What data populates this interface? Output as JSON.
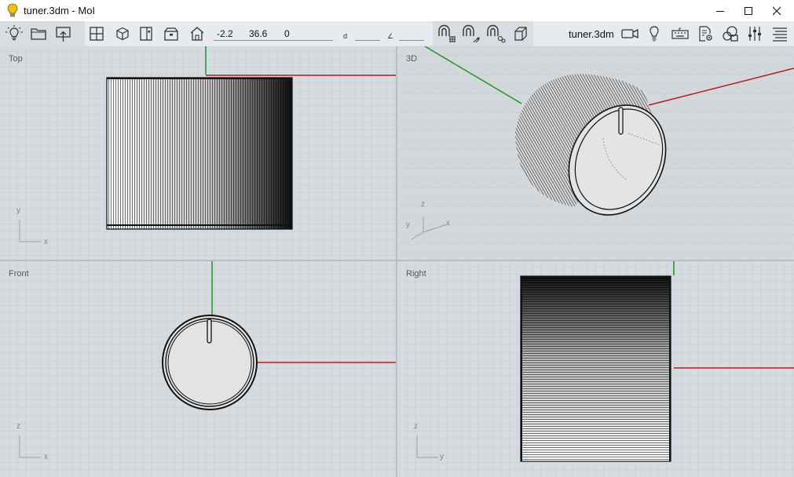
{
  "window": {
    "title": "tuner.3dm - MoI"
  },
  "toolbar": {
    "coord_x": "-2.2",
    "coord_y": "36.6",
    "coord_z": "0",
    "distance_label": "d",
    "angle_label": "∠",
    "file_name": "tuner.3dm",
    "icons": [
      "lightbulb-icon",
      "open-folder-icon",
      "import-icon",
      "four-view-icon",
      "box-3d-icon",
      "front-view-icon",
      "top-view-icon",
      "home-view-icon",
      "magnet-grid-icon",
      "magnet-point-icon",
      "magnet-object-icon",
      "cube-icon",
      "camera-icon",
      "light-icon",
      "keyboard-icon",
      "document-settings-icon",
      "shapes-icon",
      "sliders-icon",
      "align-icon"
    ]
  },
  "viewports": {
    "top": {
      "label": "Top",
      "axis_h": "x",
      "axis_v": "y"
    },
    "three_d": {
      "label": "3D",
      "axis_h": "x",
      "axis_v": "z",
      "axis_d": "y"
    },
    "front": {
      "label": "Front",
      "axis_h": "x",
      "axis_v": "z"
    },
    "right": {
      "label": "Right",
      "axis_h": "y",
      "axis_v": "z"
    }
  },
  "colors": {
    "viewport_bg": "#d6dbe0",
    "grid": "#c6ccd2",
    "axis_x": "#b01c1c",
    "axis_y": "#1d9a1d",
    "toolbar_bg": "#e7ebef",
    "toolbar_group": "#d7dde3"
  }
}
